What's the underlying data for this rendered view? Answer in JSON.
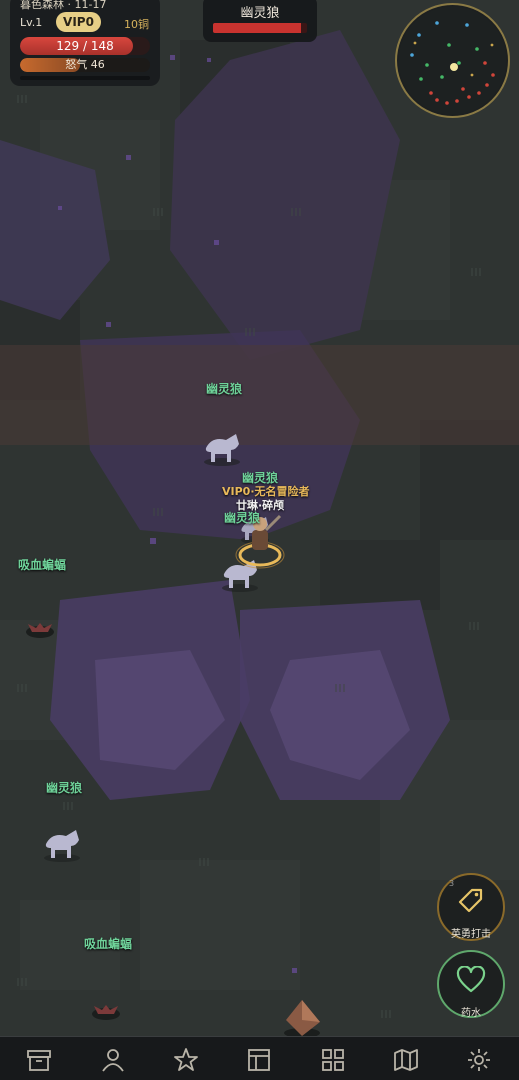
{
  "hud": {
    "zone": "暮色森林 · 11-17",
    "level": "Lv.1",
    "vip": "VIP0",
    "currency": "10铜",
    "hp_text": "129 / 148",
    "hp_fraction": 0.87,
    "rage_text": "怒气 46",
    "rage_fraction": 0.46,
    "xp_fraction": 0.02
  },
  "target": {
    "name": "幽灵狼",
    "hp_fraction": 0.94
  },
  "player": {
    "name": "VIP0·无名冒险者",
    "title": "廿琳·碎颅"
  },
  "mobs": {
    "wolf_1": "幽灵狼",
    "wolf_2": "幽灵狼",
    "wolf_3": "幽灵狼",
    "wolf_4": "幽灵狼",
    "bat_1": "吸血蝙蝠",
    "bat_2": "吸血蝙蝠"
  },
  "skills": {
    "brave_strike": {
      "label": "英勇打击",
      "icon": "tag-icon",
      "hotkey": "3"
    },
    "potion": {
      "label": "药水",
      "icon": "heart-icon"
    }
  },
  "nav": [
    "archive-icon",
    "person-icon",
    "star-icon",
    "panel-icon",
    "grid-icon",
    "map-icon",
    "settings-icon"
  ],
  "colors": {
    "accent_gold": "#e7cf86",
    "hp_red": "#c8332f",
    "mob_name_green": "#6fd39a",
    "potion_green": "#7bd38d"
  }
}
